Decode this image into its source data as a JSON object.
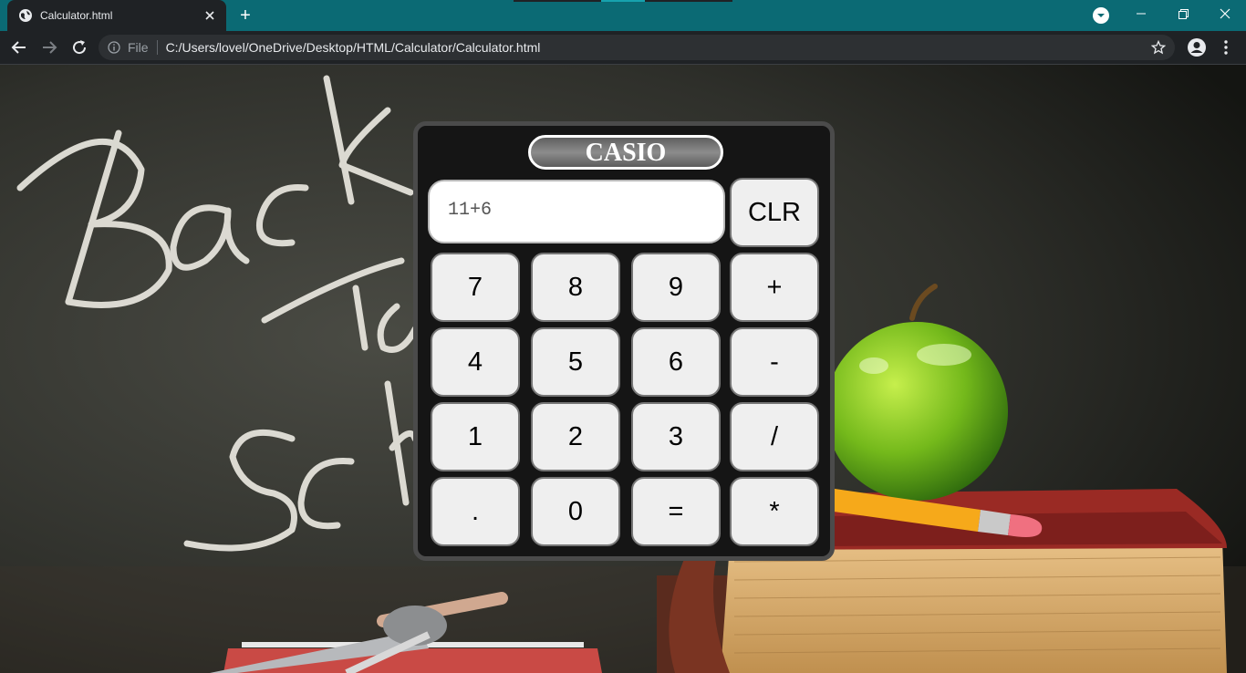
{
  "browser": {
    "tab_title": "Calculator.html",
    "new_tab_symbol": "+",
    "file_label": "File",
    "url": "C:/Users/lovel/OneDrive/Desktop/HTML/Calculator/Calculator.html",
    "colors": {
      "tab_strip": "#0b6a74",
      "toolbar": "#1f2225",
      "omnibox": "#2d3033"
    }
  },
  "calculator": {
    "brand": "CASIO",
    "display_value": "11+6",
    "clear_label": "CLR",
    "keys": [
      [
        "7",
        "8",
        "9",
        "+"
      ],
      [
        "4",
        "5",
        "6",
        "-"
      ],
      [
        "1",
        "2",
        "3",
        "/"
      ],
      [
        ".",
        "0",
        "=",
        "*"
      ]
    ]
  },
  "background": {
    "chalk_text_lines": [
      "Back",
      "To",
      "Sch"
    ]
  }
}
